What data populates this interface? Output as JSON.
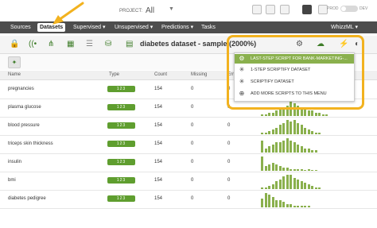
{
  "topbar": {
    "project_label": "PROJECT:",
    "project_value": "All",
    "prod_label": "PROD",
    "dev_label": "DEV"
  },
  "nav": {
    "items": [
      {
        "label": "Sources"
      },
      {
        "label": "Datasets"
      },
      {
        "label": "Supervised ▾"
      },
      {
        "label": "Unsupervised ▾"
      },
      {
        "label": "Predictions ▾"
      },
      {
        "label": "Tasks"
      }
    ],
    "user": "WhizzML ▾"
  },
  "toolbar": {
    "dataset_title": "diabetes dataset - sample (2000%)"
  },
  "table": {
    "headers": [
      "Name",
      "Type",
      "Count",
      "Missing",
      "Err"
    ],
    "type_badge": "123",
    "rows": [
      {
        "name": "pregnancies",
        "count": "154",
        "missing": "0",
        "err": "0",
        "histo": [
          2,
          9,
          7,
          4,
          5,
          3,
          6,
          3,
          2,
          1,
          2,
          1,
          1,
          1,
          0,
          1
        ]
      },
      {
        "name": "plasma glucose",
        "count": "154",
        "missing": "0",
        "err": "0",
        "histo": [
          1,
          1,
          2,
          2,
          3,
          4,
          5,
          6,
          8,
          7,
          6,
          5,
          4,
          3,
          3,
          2,
          2,
          1,
          1
        ]
      },
      {
        "name": "blood pressure",
        "count": "154",
        "missing": "0",
        "err": "0",
        "histo": [
          1,
          1,
          2,
          3,
          4,
          6,
          7,
          9,
          8,
          9,
          7,
          6,
          4,
          3,
          2,
          1,
          1
        ]
      },
      {
        "name": "triceps skin thickness",
        "count": "154",
        "missing": "0",
        "err": "0",
        "histo": [
          6,
          2,
          3,
          4,
          5,
          5,
          6,
          7,
          6,
          5,
          4,
          3,
          2,
          2,
          1,
          1
        ]
      },
      {
        "name": "insulin",
        "count": "154",
        "missing": "0",
        "err": "0",
        "histo": [
          9,
          3,
          4,
          5,
          4,
          3,
          2,
          2,
          1,
          1,
          1,
          1,
          0,
          1,
          0,
          0
        ]
      },
      {
        "name": "bmi",
        "count": "154",
        "missing": "0",
        "err": "0",
        "histo": [
          1,
          1,
          2,
          3,
          5,
          6,
          8,
          9,
          9,
          7,
          6,
          5,
          4,
          3,
          2,
          1,
          1
        ]
      },
      {
        "name": "diabetes pedigree",
        "count": "154",
        "missing": "0",
        "err": "0",
        "histo": [
          5,
          8,
          7,
          6,
          4,
          4,
          3,
          2,
          2,
          1,
          1,
          1,
          1,
          1
        ]
      }
    ]
  },
  "menu": {
    "items": [
      {
        "label": "LAST-STEP SCRIPT FOR BANK-MARKETING-...",
        "icon": "script-icon",
        "highlighted": true
      },
      {
        "label": "1-STEP SCRIPTIFY DATASET",
        "icon": "sparkle-icon",
        "highlighted": false
      },
      {
        "label": "SCRIPTIFY DATASET",
        "icon": "sparkle-icon",
        "highlighted": false
      },
      {
        "label": "ADD MORE SCRIPTS TO THIS MENU",
        "icon": "add-script-icon",
        "highlighted": false
      }
    ]
  },
  "colors": {
    "accent_green": "#5f9e2f",
    "histo_green": "#8ab04d",
    "callout_yellow": "#f2b21f",
    "nav_dark": "#4d4d4d"
  }
}
